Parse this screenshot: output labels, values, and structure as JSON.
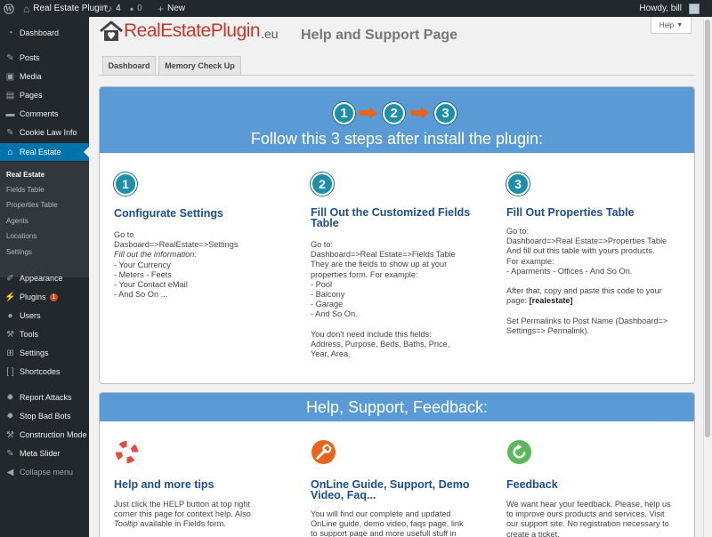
{
  "adminbar": {
    "site_name": "Real Estate Plugin",
    "updates_count": "4",
    "comments_count": "0",
    "new_label": "New",
    "howdy": "Howdy, bill"
  },
  "sidebar": {
    "dashboard": "Dashboard",
    "posts": "Posts",
    "media": "Media",
    "pages": "Pages",
    "comments": "Comments",
    "cookie_law": "Cookie Law Info",
    "real_estate": "Real Estate",
    "submenu": [
      "Real Estate",
      "Fields Table",
      "Properties Table",
      "Agents",
      "Locations",
      "Settings"
    ],
    "appearance": "Appearance",
    "plugins": "Plugins",
    "plugins_badge": "1",
    "users": "Users",
    "tools": "Tools",
    "settings": "Settings",
    "shortcodes": "Shortcodes",
    "report_attacks": "Report Attacks",
    "stop_bad_bots": "Stop Bad Bots",
    "construction_mode": "Construction Mode",
    "meta_slider": "Meta Slider",
    "collapse": "Collapse menu"
  },
  "header": {
    "logo_main": "RealEstatePlugin",
    "logo_suffix": ".eu",
    "page_title": "Help and Support Page",
    "help_button": "Help"
  },
  "tabs": [
    "Dashboard",
    "Memory Check Up"
  ],
  "steps_panel": {
    "numbers": [
      "1",
      "2",
      "3"
    ],
    "heading": "Follow this 3 steps after install the plugin:",
    "columns": [
      {
        "number": "1",
        "title": "Configurate Settings",
        "lines": [
          "Go to",
          "Dasboard=>RealEstate=>Settings",
          "Fill out the information:",
          "- Your Currency",
          "- Meters - Feets",
          "- Your Contact eMail",
          "- And So On ..."
        ]
      },
      {
        "number": "2",
        "title": "Fill Out the Customized Fields Table",
        "lines": [
          "Go to:",
          "Dashboard=>Real Estate=>Fields Table",
          "They are the fields to show up at your properties form. For example:",
          "- Pool",
          "- Balcony",
          "- Garage",
          "- And So On.",
          "",
          "You don't need include this fields: Address, Purpose, Beds, Baths, Price, Year, Area."
        ]
      },
      {
        "number": "3",
        "title": "Fill Out Properties Table",
        "lines": [
          "Go to:",
          "Dashboard=>Real Estate=>Properties Table",
          "And fill out this table with yours products.",
          "For example:",
          "- Aparments - Offices - And So On.",
          "",
          "After that, copy and paste this code to your page:",
          "[realestate]",
          "",
          "Set Permalinks to Post Name (Dashboard=> Settings=> Permalink)."
        ]
      }
    ]
  },
  "help_panel": {
    "heading": "Help, Support, Feedback:",
    "columns": [
      {
        "icon": "lifebuoy-icon",
        "title": "Help and more tips",
        "text1": "Just click the HELP button at top right corner this page for context help. Also",
        "text2_italic": "Tooltip",
        "text3": "available in Fields form."
      },
      {
        "icon": "wrench-icon",
        "title": "OnLine Guide, Support, Demo Video, Faq...",
        "text": "You will find our complete and updated OnLine guide, demo video, faqs page, link to support page and more usefull stuff in"
      },
      {
        "icon": "refresh-icon",
        "title": "Feedback",
        "text": "We want hear your feedback. Please, help us to improve ours products and services. Visit our support site. No registration necessary to create a ticket."
      }
    ]
  },
  "colors": {
    "panel_header": "#5a9bd5",
    "title_blue": "#1d4e89",
    "step_circle": "#1e8fa8",
    "arrow_orange": "#e8641b",
    "admin_dark": "#23282d",
    "active_blue": "#0073aa"
  }
}
